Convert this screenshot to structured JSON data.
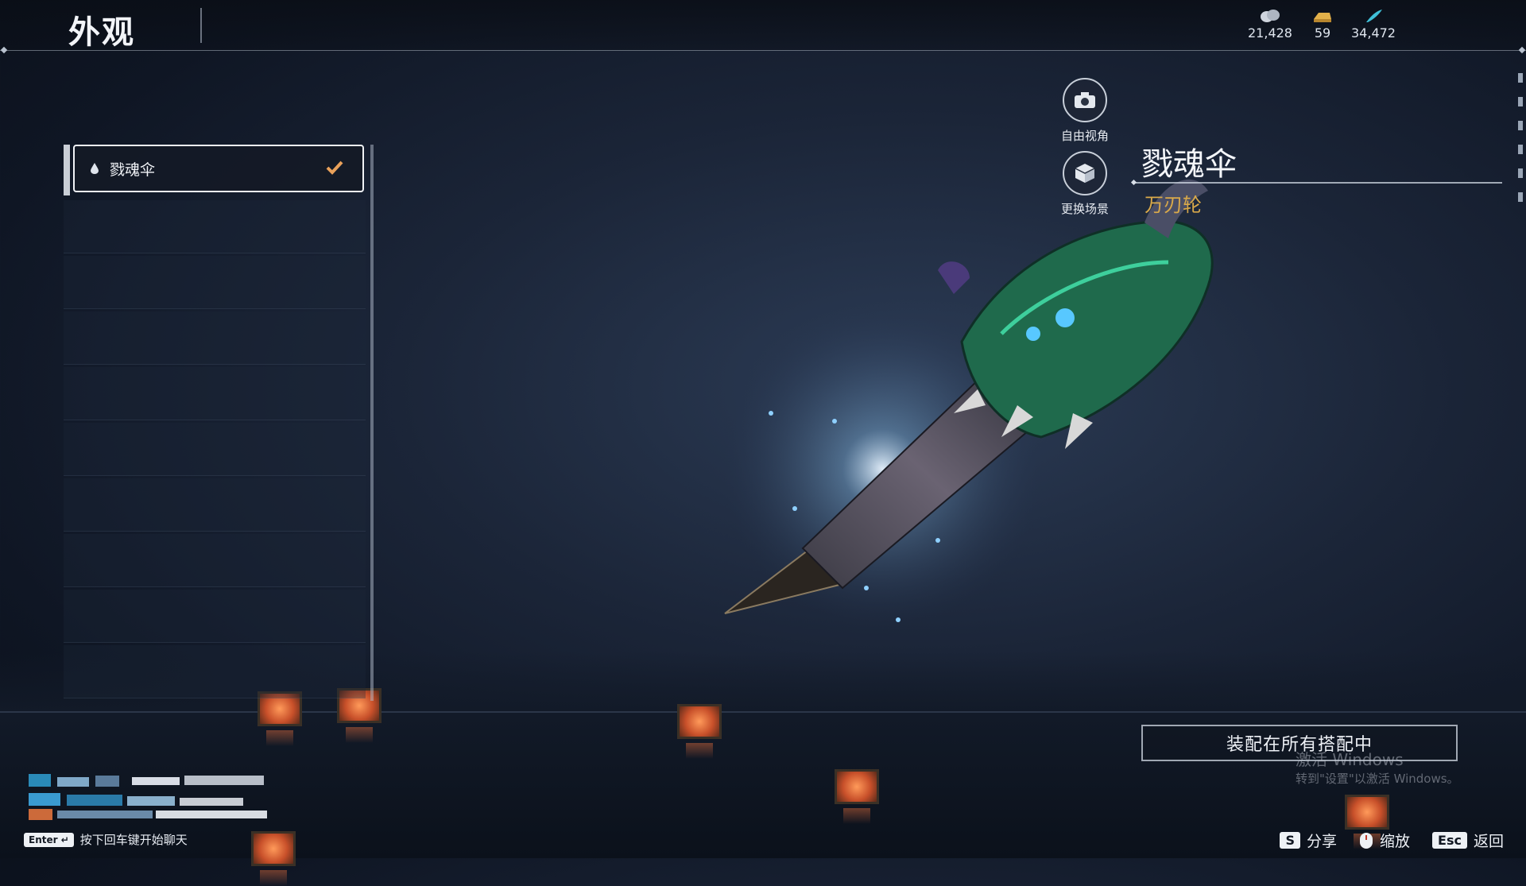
{
  "header": {
    "title": "外观",
    "currencies": [
      {
        "name": "silver-coin-icon",
        "value": "21,428"
      },
      {
        "name": "gold-ingot-icon",
        "value": "59"
      },
      {
        "name": "feather-icon",
        "value": "34,472"
      }
    ]
  },
  "list": {
    "selected_item": "戮魂伞"
  },
  "actions": {
    "free_view": "自由视角",
    "change_scene": "更换场景"
  },
  "item": {
    "name": "戮魂伞",
    "type": "万刃轮"
  },
  "equip_button": "装配在所有搭配中",
  "watermark": {
    "line1": "激活 Windows",
    "line2": "转到\"设置\"以激活 Windows。"
  },
  "chat": {
    "key": "Enter",
    "hint": "按下回车键开始聊天"
  },
  "hotkeys": [
    {
      "key": "S",
      "label": "分享"
    },
    {
      "key": "",
      "label": "缩放"
    },
    {
      "key": "Esc",
      "label": "返回"
    }
  ],
  "colors": {
    "accent_gold": "#d9a94a",
    "check_orange": "#e9a15a"
  }
}
